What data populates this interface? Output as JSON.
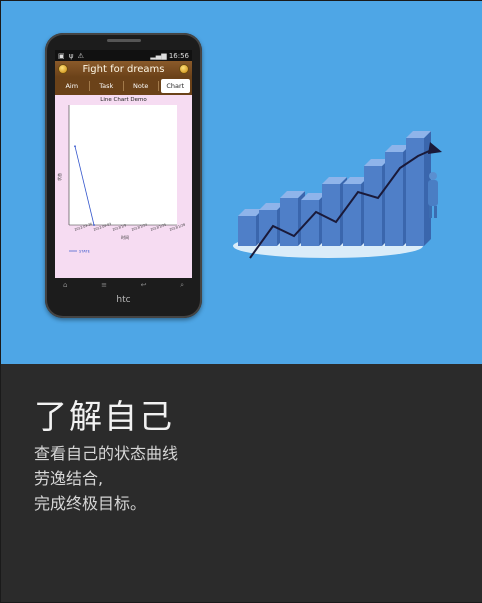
{
  "phone": {
    "status_time": "16:56",
    "app_title": "Fight for dreams",
    "brand": "htc",
    "tabs": [
      {
        "label": "Aim",
        "active": false
      },
      {
        "label": "Task",
        "active": false
      },
      {
        "label": "Note",
        "active": false
      },
      {
        "label": "Chart",
        "active": true
      }
    ],
    "chart_title": "Line Chart Demo"
  },
  "chart_data": {
    "type": "line",
    "title": "Line Chart Demo",
    "xlabel": "时间",
    "ylabel": "状态",
    "x": [
      "2012-03-26",
      "2012-04-03",
      "2013/1/9",
      "2013/1/24",
      "2013/1/25",
      "2013/1/28"
    ],
    "series": [
      {
        "name": "STATE",
        "values": [
          2,
          0,
          null,
          null,
          null,
          null
        ]
      }
    ],
    "legend_position": "bottom-left",
    "color": "#3355cc"
  },
  "content": {
    "heading": "了解自己",
    "lines": [
      "查看自己的状态曲线",
      "劳逸结合,",
      "完成终极目标。"
    ]
  }
}
